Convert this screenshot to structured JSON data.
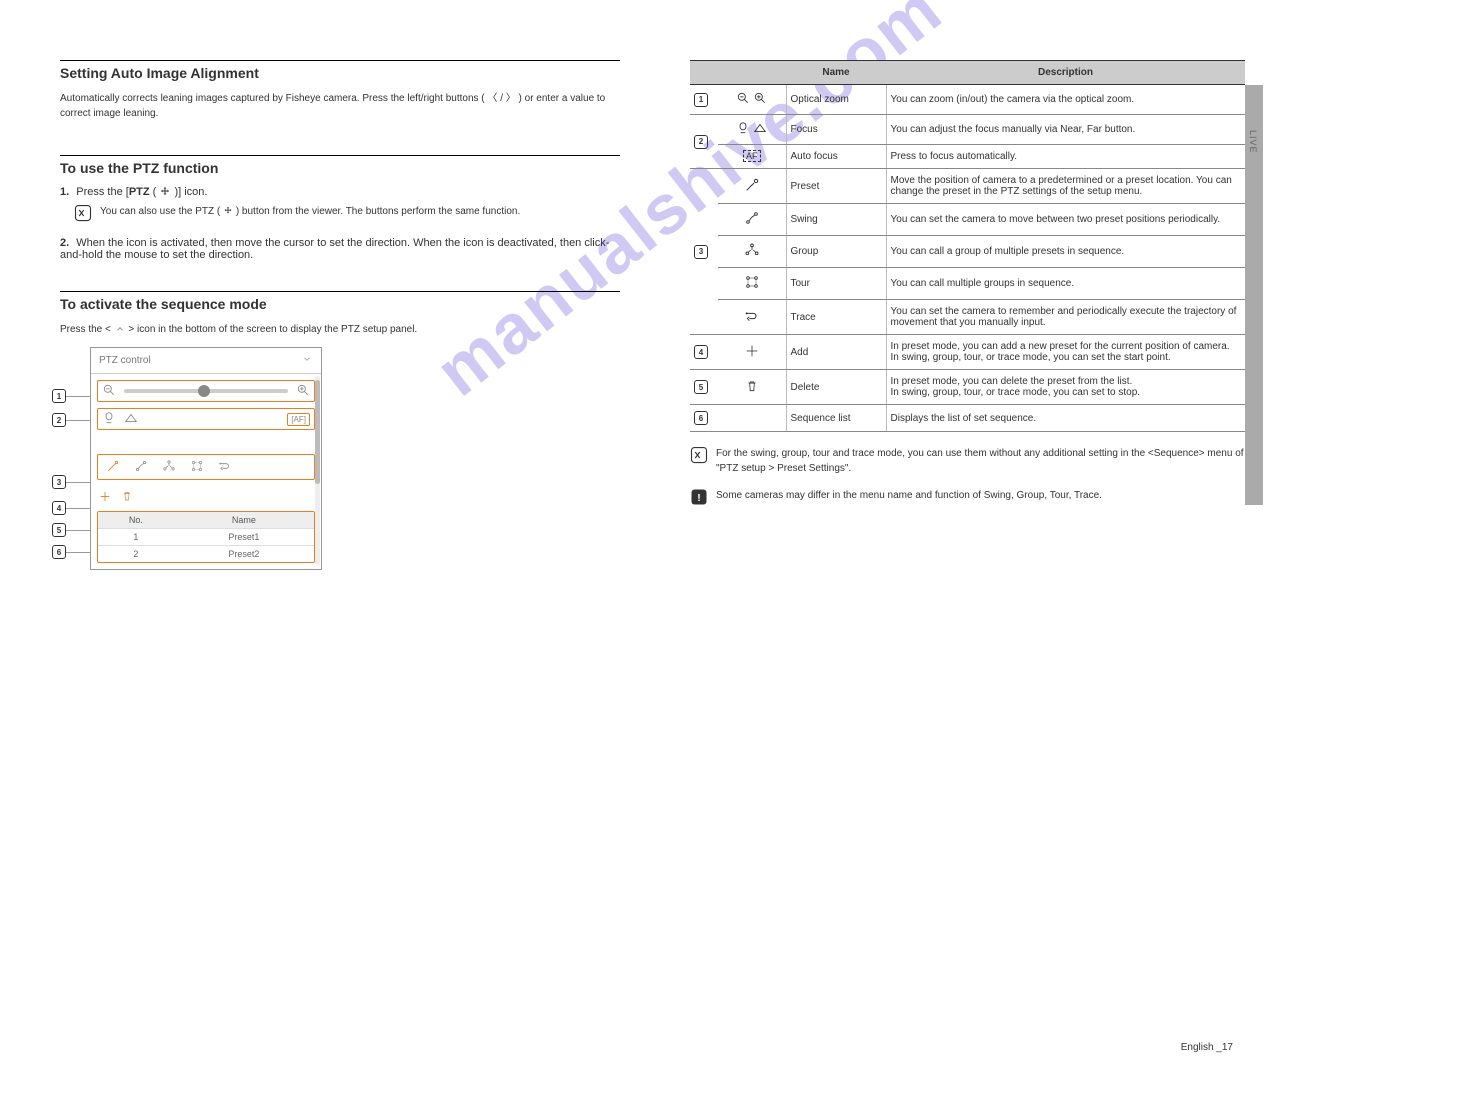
{
  "side_label": "LIVE",
  "page_number": "English _17",
  "watermark": "manualshive.com",
  "left": {
    "sec1": {
      "title": "Setting Auto Image Alignment",
      "body": "Automatically corrects leaning images captured by Fisheye camera. Press the left/right buttons ( 〈 / 〉 ) or enter a value to correct image leaning."
    },
    "sec2": {
      "title": "To use the PTZ function",
      "step1_num": "1.",
      "step1": "Press the [PTZ (      )] icon.",
      "note": "You can also use the PTZ (      ) button from the viewer. The buttons perform the same function.",
      "step2_num": "2.",
      "step2": "When the icon is activated, then move the cursor to set the direction. When the icon is deactivated, then click-and-hold the mouse to set the direction."
    },
    "sec3": {
      "title": "To activate the sequence mode",
      "step": "Press the <      > icon in the bottom of the screen to display the PTZ setup panel."
    },
    "ptz_panel": {
      "title": "PTZ control",
      "table": {
        "col_no": "No.",
        "col_name": "Name",
        "r1_no": "1",
        "r1_name": "Preset1",
        "r2_no": "2",
        "r2_name": "Preset2"
      }
    },
    "callouts": [
      "1",
      "2",
      "3",
      "4",
      "5",
      "6"
    ]
  },
  "right": {
    "headers": {
      "name": "Name",
      "desc": "Description"
    },
    "rows": [
      {
        "idx": "1",
        "name": "Optical zoom",
        "desc": "You can zoom (in/out) the camera via the optical zoom."
      },
      {
        "idx": "2",
        "name": "Focus",
        "desc": "You can adjust the focus manually via Near, Far button.",
        "name2": "Auto focus",
        "desc2": "Press to focus automatically."
      },
      {
        "idx": "3",
        "sub": [
          {
            "name": "Preset",
            "desc": "Move the position of camera to a predetermined or a preset location. You can change the preset in the PTZ settings of the setup menu."
          },
          {
            "name": "Swing",
            "desc": "You can set the camera to move between two preset positions periodically."
          },
          {
            "name": "Group",
            "desc": "You can call a group of multiple presets in sequence."
          },
          {
            "name": "Tour",
            "desc": "You can call multiple groups in sequence."
          },
          {
            "name": "Trace",
            "desc": "You can set the camera to remember and periodically execute the trajectory of movement that you manually input."
          }
        ]
      },
      {
        "idx": "4",
        "name": "Add",
        "desc": "In preset mode, you can add a new preset for the current position of camera.\nIn swing, group, tour, or trace mode, you can set the start point."
      },
      {
        "idx": "5",
        "name": "Delete",
        "desc": "In preset mode, you can delete the preset from the list.\nIn swing, group, tour, or trace mode, you can set to stop."
      },
      {
        "idx": "6",
        "name": "Sequence list",
        "desc": "Displays the list of set sequence."
      }
    ],
    "note1": "For the swing, group, tour and trace mode, you can use them without any additional setting in the <Sequence> menu of \"PTZ setup > Preset Settings\".",
    "note2": "Some cameras may differ in the menu name and function of Swing, Group, Tour, Trace."
  }
}
